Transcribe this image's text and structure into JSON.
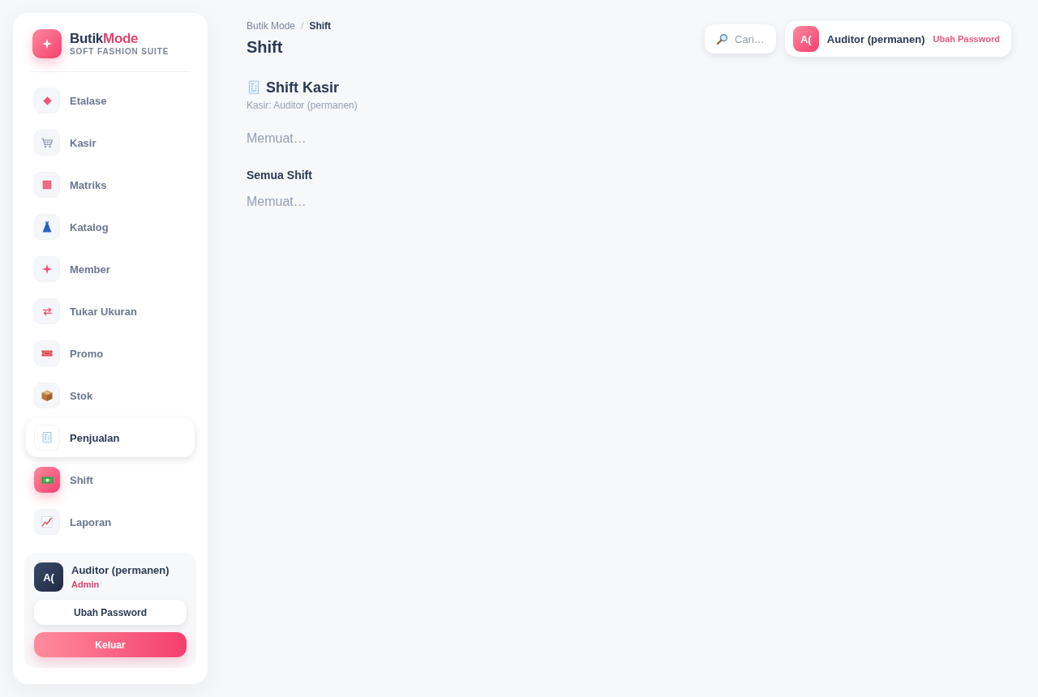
{
  "sidebar": {
    "brand": {
      "name": "Butik",
      "accent": "Mode",
      "tagline": "SOFT FASHION SUITE"
    },
    "nav": [
      {
        "label": "Etalase",
        "selected": false,
        "hovered": false
      },
      {
        "label": "Kasir",
        "selected": false,
        "hovered": false
      },
      {
        "label": "Matriks",
        "selected": false,
        "hovered": false
      },
      {
        "label": "Katalog",
        "selected": false,
        "hovered": false
      },
      {
        "label": "Member",
        "selected": false,
        "hovered": false
      },
      {
        "label": "Tukar Ukuran",
        "selected": false,
        "hovered": false
      },
      {
        "label": "Promo",
        "selected": false,
        "hovered": false
      },
      {
        "label": "Stok",
        "selected": false,
        "hovered": false
      },
      {
        "label": "Penjualan",
        "selected": false,
        "hovered": true
      },
      {
        "label": "Shift",
        "selected": true,
        "hovered": false
      },
      {
        "label": "Laporan",
        "selected": false,
        "hovered": false
      }
    ],
    "user_card": {
      "avatar": "A(",
      "name": "Auditor (permanen)",
      "role": "Admin",
      "buttons": [
        {
          "label": "Ubah Password",
          "kind": "secondary"
        },
        {
          "label": "Keluar",
          "kind": "danger"
        }
      ]
    }
  },
  "header": {
    "breadcrumb": {
      "separator": "/",
      "items": [
        {
          "label": "Butik Mode",
          "current": false
        },
        {
          "label": "Shift",
          "current": true
        }
      ]
    },
    "title": "Shift",
    "search": {
      "label": "Cari…"
    },
    "user": {
      "avatar": "A(",
      "name": "Auditor (permanen)",
      "link": "Ubah Password"
    }
  },
  "sections": [
    {
      "kind": "primary",
      "title": "Shift Kasir",
      "subtitle": "Kasir: Auditor (permanen)",
      "status": "Memuat…"
    },
    {
      "kind": "secondary",
      "title": "Semua Shift",
      "status": "Memuat…"
    }
  ]
}
